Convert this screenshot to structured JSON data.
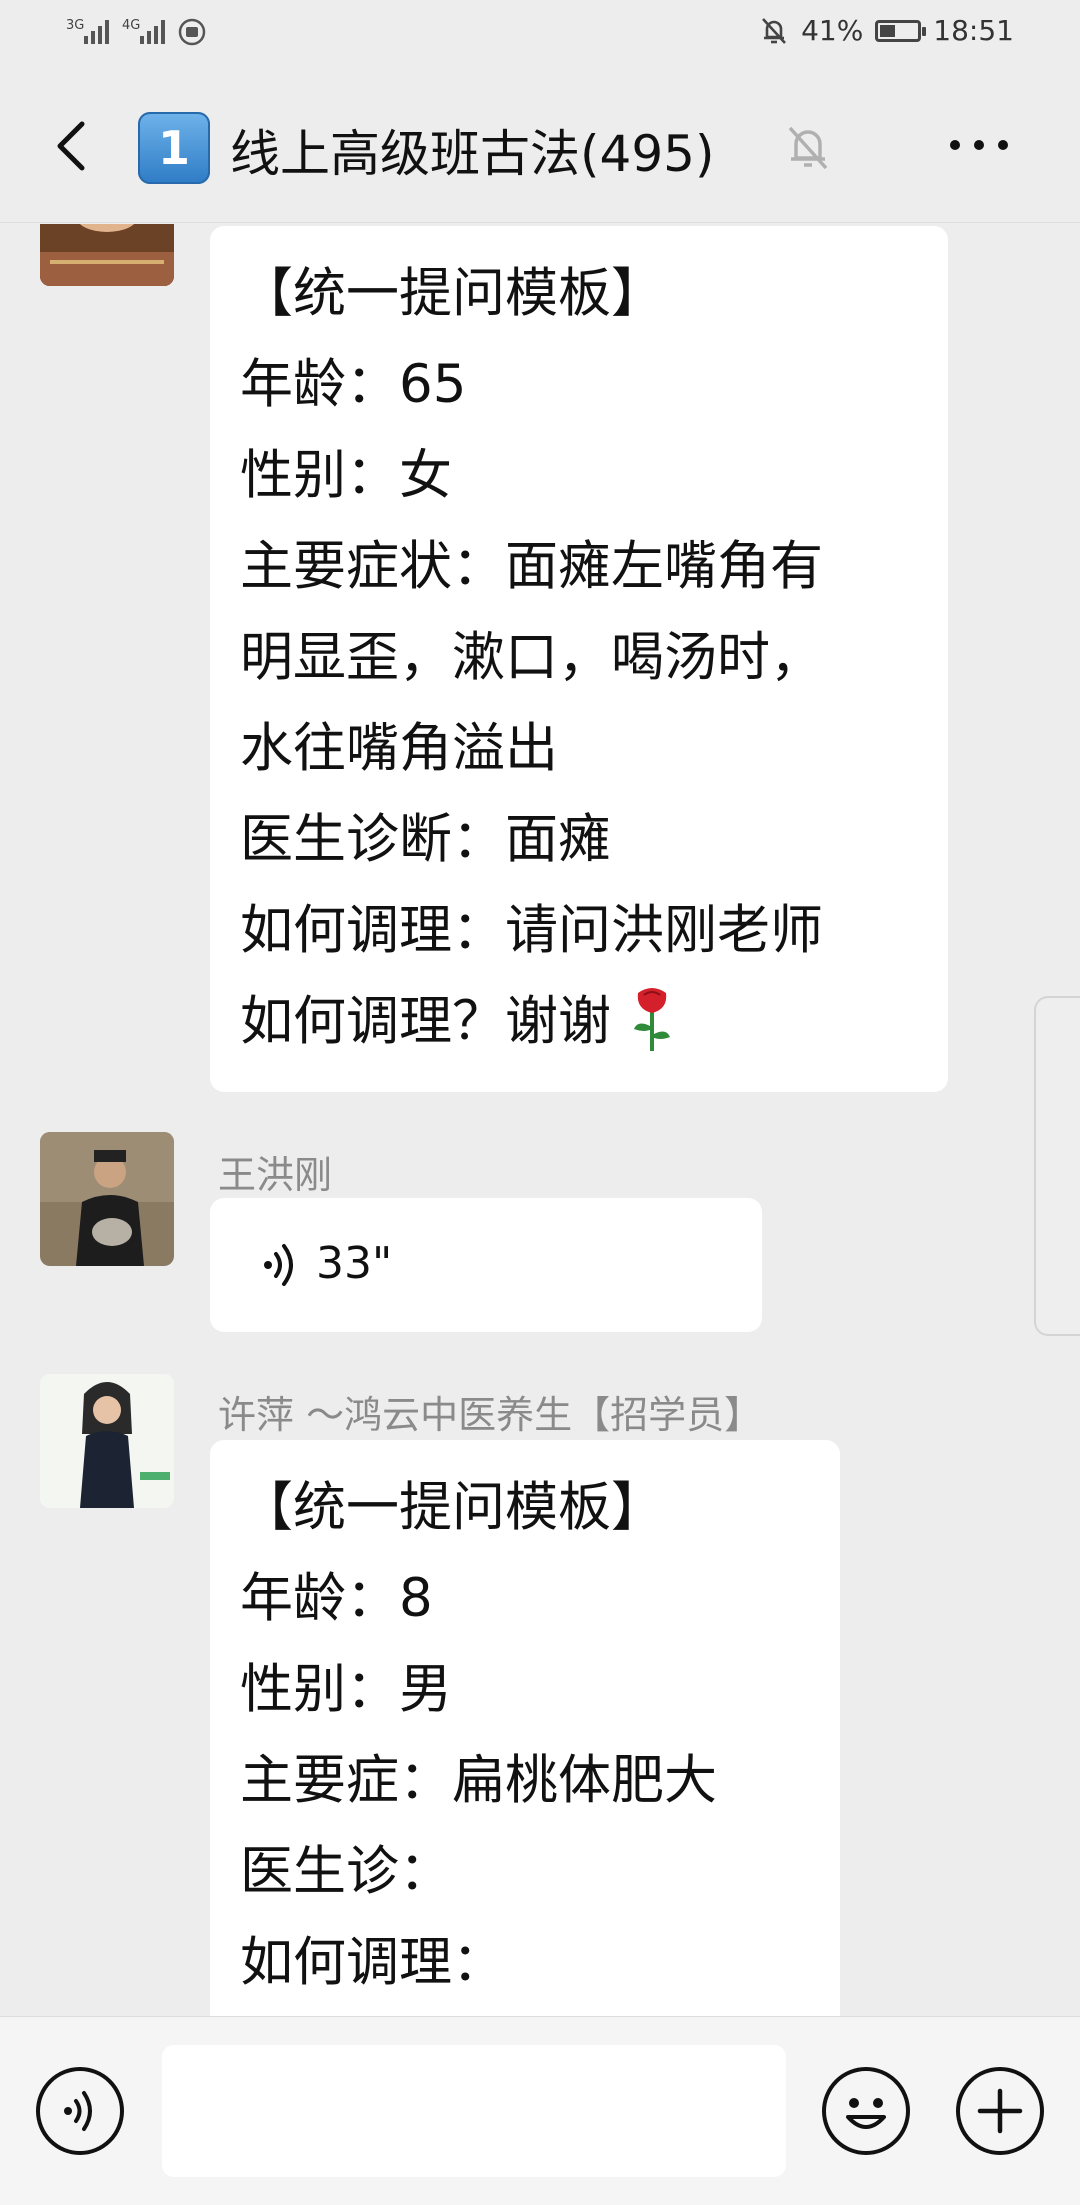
{
  "status_bar": {
    "network1": "3G",
    "network2": "4G",
    "battery_percent": "41%",
    "battery_level": 0.41,
    "time": "18:51"
  },
  "header": {
    "unread_count": "1",
    "title": "线上高级班古法(495)"
  },
  "messages": [
    {
      "sender": "",
      "lines": [
        "【统一提问模板】",
        "年龄：65",
        "性别：女",
        "主要症状：面瘫左嘴角有",
        "明显歪，漱口，喝汤时，",
        "水往嘴角溢出",
        "医生诊断：面瘫",
        "如何调理：请问洪刚老师",
        "如何调理？谢谢"
      ],
      "emoji": "🌹"
    },
    {
      "sender": "王洪刚",
      "voice_duration": "33\""
    },
    {
      "sender": "许萍 ～鸿云中医养生【招学员】",
      "lines": [
        "【统一提问模板】",
        "年龄：8",
        "性别：男",
        "主要症：扁桃体肥大",
        "医生诊：",
        "如何调理："
      ]
    }
  ],
  "colors": {
    "background": "#ededed",
    "bubble": "#ffffff",
    "sender_name": "#8a8a8a",
    "badge": "#3d8fd8",
    "rose": "#d3202a"
  }
}
